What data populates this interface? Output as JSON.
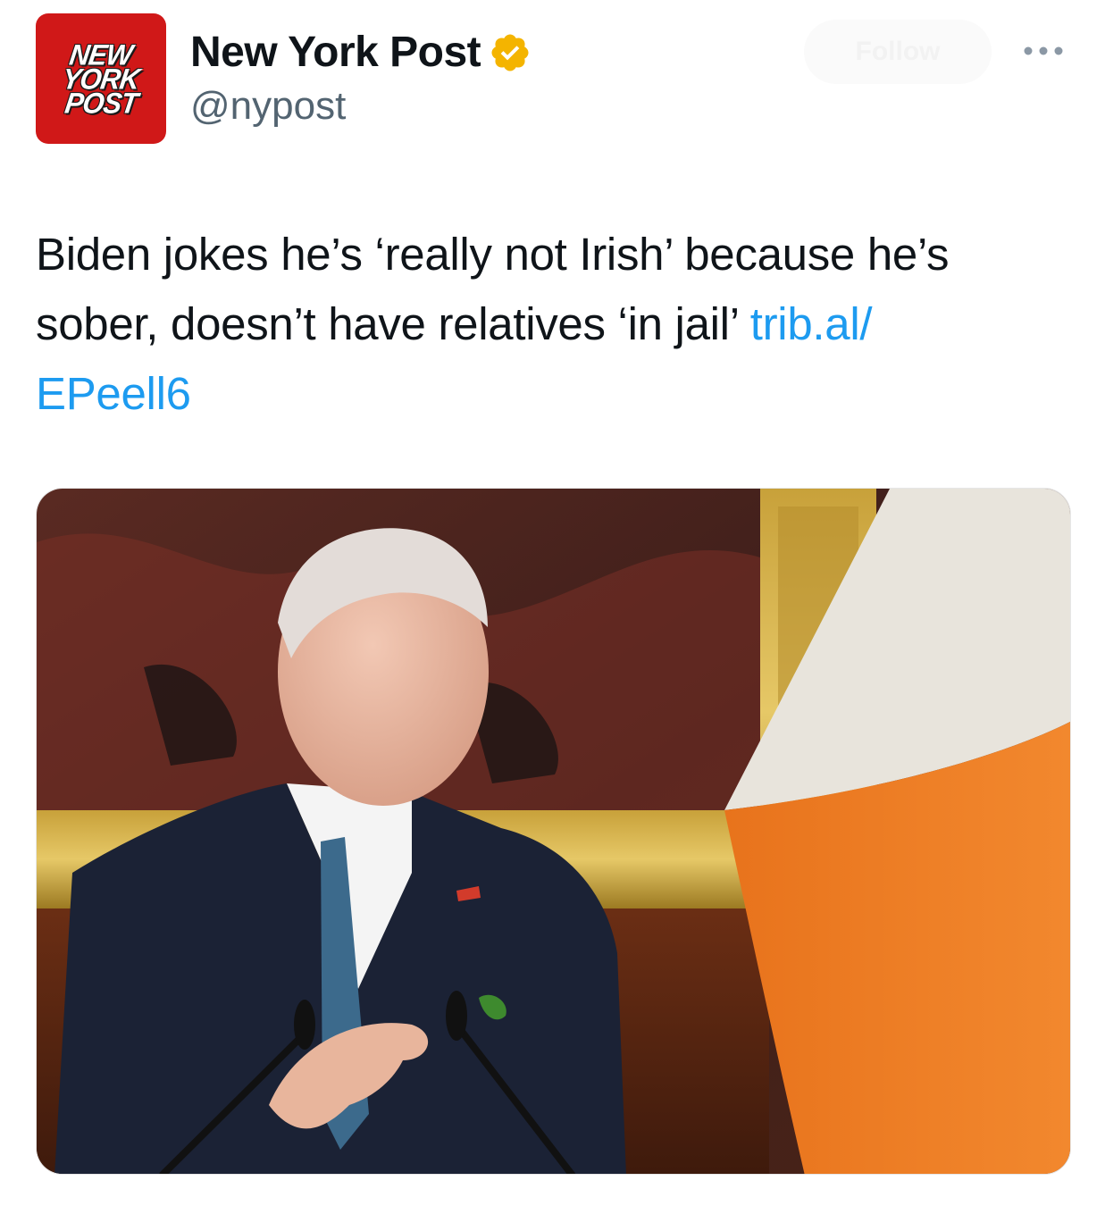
{
  "tweet": {
    "author": {
      "logo_lines": [
        "NEW",
        "YORK",
        "POST"
      ],
      "display_name": "New York Post",
      "handle": "@nypost",
      "verified_icon": "verified-badge-icon",
      "verified_color": "#f4b400"
    },
    "follow_label": "Follow",
    "more_icon": "more-horizontal-icon",
    "text_line_1": "Biden jokes he’s ‘really not Irish’ because he’s",
    "text_line_2": "sober, doesn’t have relatives ‘in jail’",
    "link_part_1": "trib.al/",
    "link_part_2": "EPeell6",
    "link_color": "#1d9bf0",
    "media_image": "photo-speaker-at-podium-with-irish-flag"
  }
}
